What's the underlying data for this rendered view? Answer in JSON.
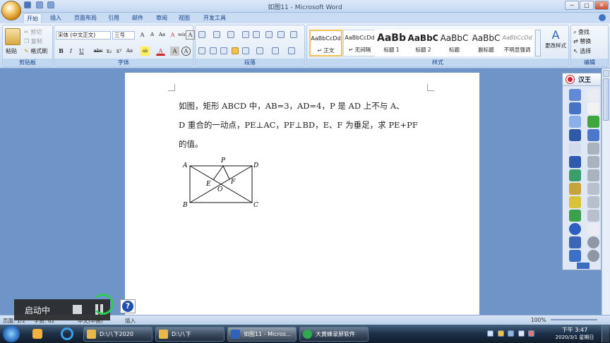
{
  "window": {
    "title": "如图11 - Microsoft Word",
    "min": "─",
    "max": "□",
    "close": "✕"
  },
  "tabs": [
    "开始",
    "插入",
    "页面布局",
    "引用",
    "邮件",
    "审阅",
    "视图",
    "开发工具"
  ],
  "clipboard": {
    "paste": "粘贴",
    "cut": "剪切",
    "copy": "复制",
    "format_painter": "格式刷",
    "label": "剪贴板"
  },
  "font": {
    "name": "宋体 (中文正文)",
    "size": "三号",
    "label": "字体",
    "buttons": [
      "A",
      "A",
      "Aa",
      "A",
      "wén",
      "A"
    ],
    "row2": [
      "B",
      "I",
      "U",
      "abc",
      "x₂",
      "x²",
      "Aa",
      "ab",
      "A",
      "A",
      "A"
    ]
  },
  "paragraph": {
    "label": "段落"
  },
  "styles": {
    "label": "样式",
    "items": [
      {
        "sample": "AaBbCcDd",
        "name": "↵ 正文"
      },
      {
        "sample": "AaBbCcDd",
        "name": "↵ 无间隔"
      },
      {
        "sample": "AaBb",
        "name": "标题 1"
      },
      {
        "sample": "AaBbC",
        "name": "标题 2"
      },
      {
        "sample": "AaBbC",
        "name": "标题"
      },
      {
        "sample": "AaBbC",
        "name": "副标题"
      },
      {
        "sample": "AaBbCcDd",
        "name": "不明显强调"
      }
    ],
    "change": "更改样式"
  },
  "editing": {
    "label": "编辑",
    "find": "查找",
    "replace": "替换",
    "select": "选择"
  },
  "document": {
    "line1": "如图，矩形 ABCD 中，AB=3，AD=4，P 是 AD 上不与 A、",
    "line2": "D 重合的一动点，PE⊥AC，PF⊥BD，E、F 为垂足，求 PE+PF",
    "line3": "的值。",
    "figure_labels": {
      "A": "A",
      "B": "B",
      "C": "C",
      "D": "D",
      "P": "P",
      "E": "E",
      "F": "F",
      "O": "O"
    }
  },
  "status": {
    "page": "页面: 1/2",
    "words": "字数: 62",
    "lang": "中文(中国)",
    "insert": "插入",
    "zoom": "100%"
  },
  "recorder": {
    "status": "启动中",
    "help": "?"
  },
  "toolbar_title": "汉王",
  "taskbar": {
    "items": [
      {
        "label": "D:\\八下2020",
        "color": "#e8b84a"
      },
      {
        "label": "D:\\八下",
        "color": "#e8b84a"
      },
      {
        "label": "如图11 - Micros...",
        "color": "#2f62b8"
      },
      {
        "label": "大黄蜂录屏软件",
        "color": "#2fa84f"
      }
    ],
    "time": "下午 3:47",
    "date": "2020/3/1 星期日"
  }
}
